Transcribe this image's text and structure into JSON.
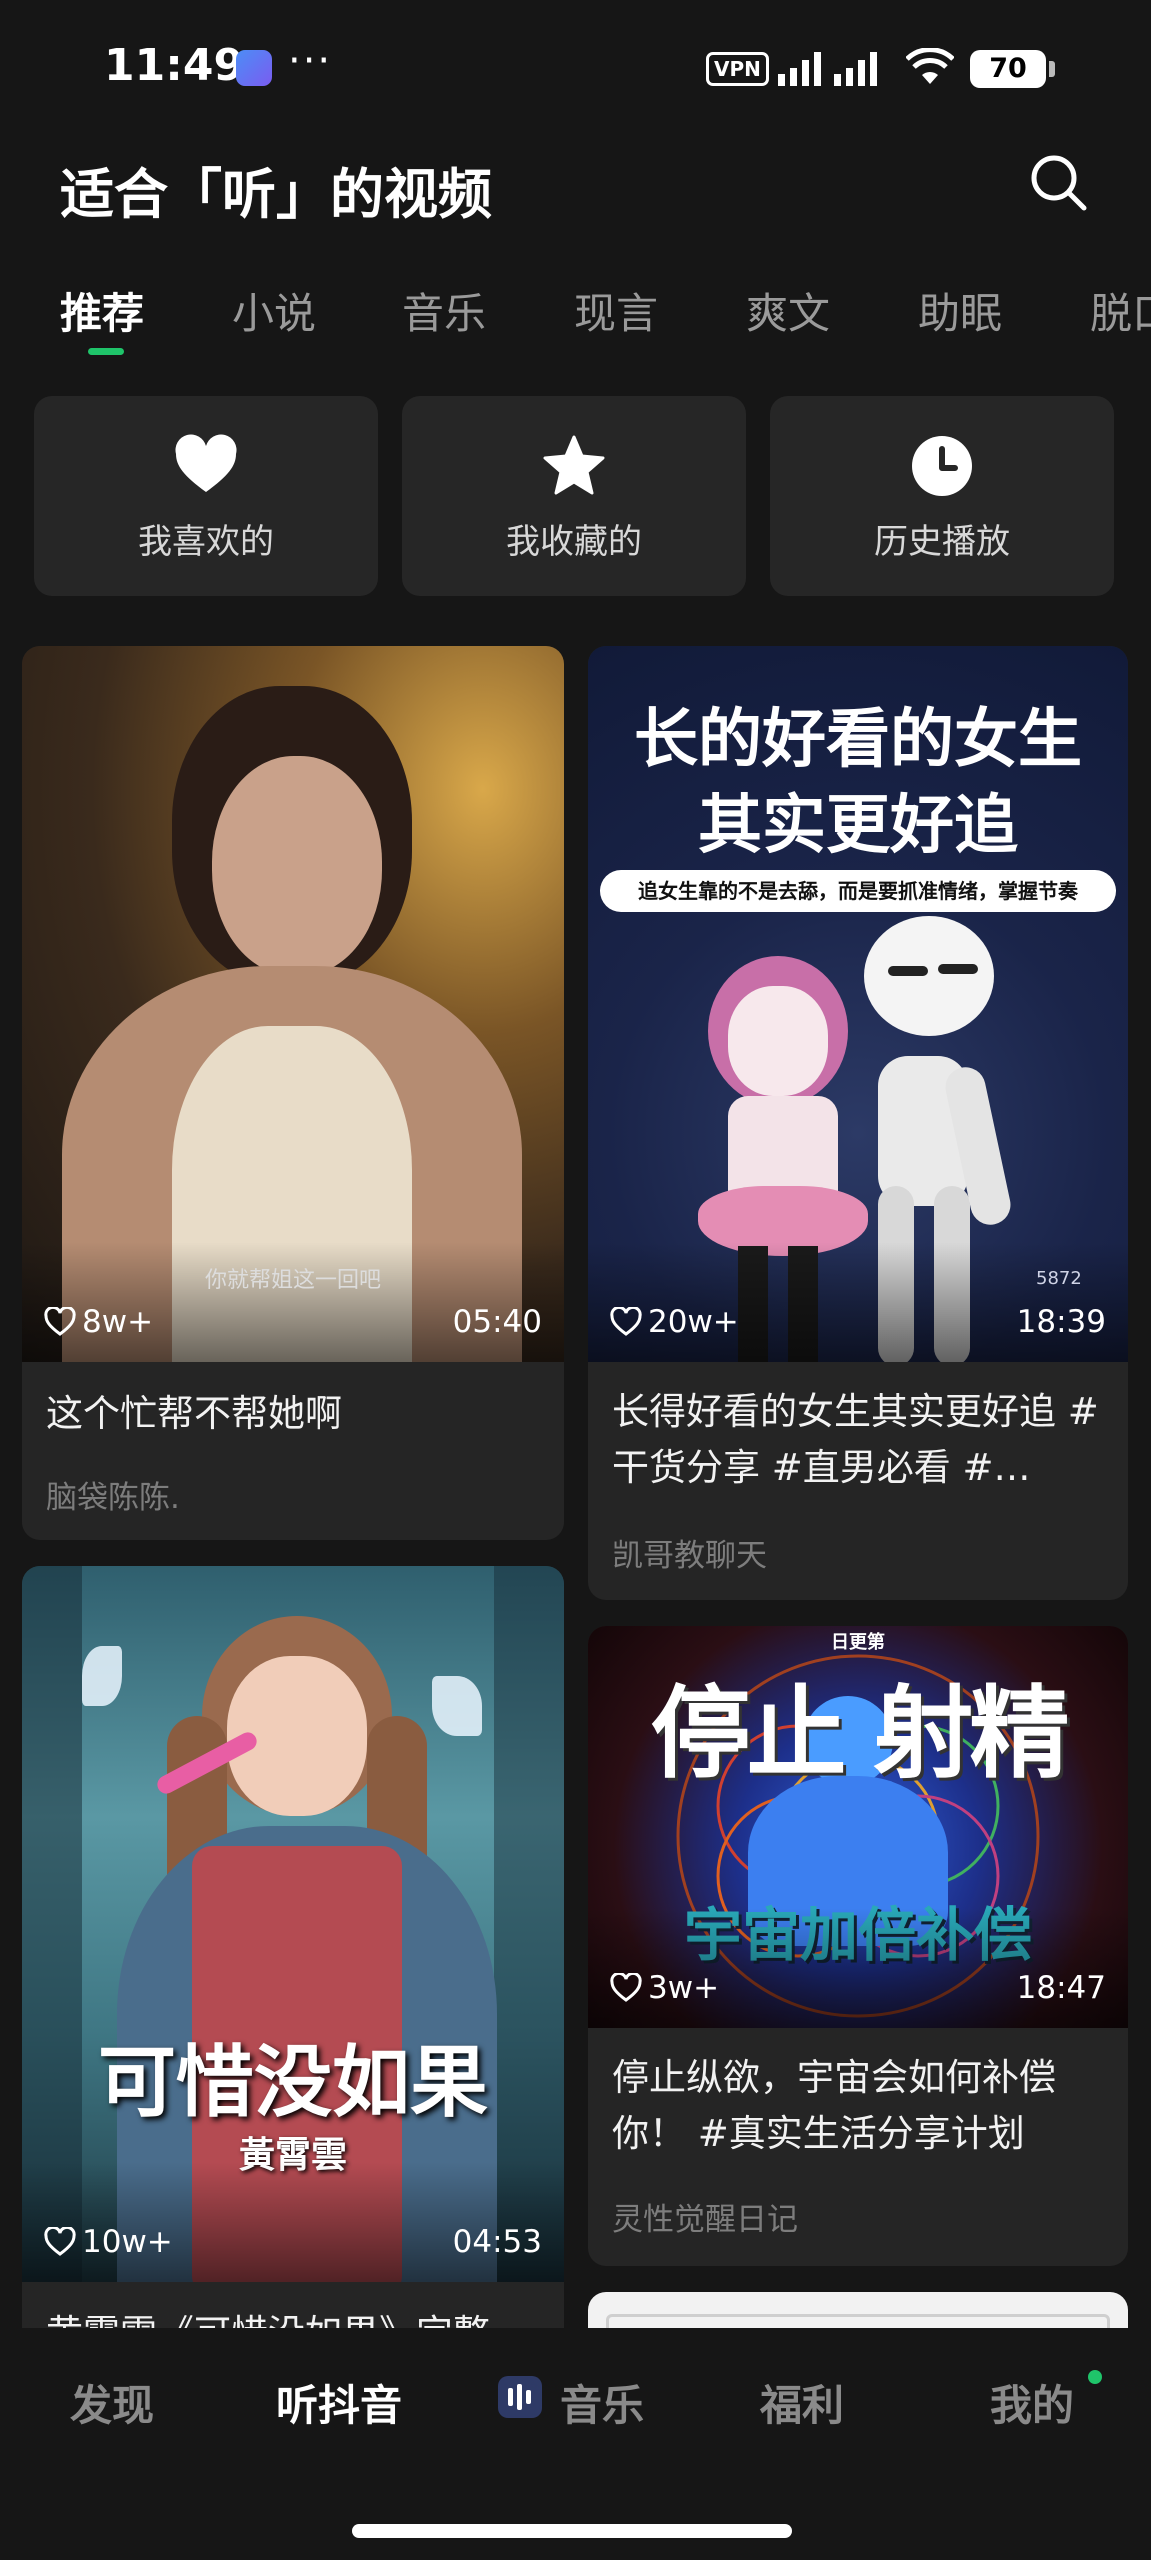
{
  "status_bar": {
    "time": "11:49",
    "dots": "···",
    "vpn": "VPN",
    "battery": "70"
  },
  "header": {
    "title": "适合「听」的视频"
  },
  "tabs": [
    {
      "label": "推荐",
      "active": true
    },
    {
      "label": "小说"
    },
    {
      "label": "音乐"
    },
    {
      "label": "现言"
    },
    {
      "label": "爽文"
    },
    {
      "label": "助眠"
    },
    {
      "label": "脱口"
    }
  ],
  "quick": [
    {
      "label": "我喜欢的",
      "icon": "heart-icon"
    },
    {
      "label": "我收藏的",
      "icon": "star-icon"
    },
    {
      "label": "历史播放",
      "icon": "clock-icon"
    }
  ],
  "cards": [
    {
      "likes": "8w+",
      "duration": "05:40",
      "title": "这个忙帮不帮她啊",
      "author": "脑袋陈陈.",
      "subtitle": "你就帮姐这一回吧"
    },
    {
      "likes": "20w+",
      "duration": "18:39",
      "title": "长得好看的女生其实更好追 #干货分享 #直男必看 #…",
      "author": "凯哥教聊天",
      "thumb_text_1": "长的好看的女生",
      "thumb_text_2": "其实更好追",
      "thumb_banner": "追女生靠的不是去舔，而是要抓准情绪，掌握节奏",
      "thumb_number": "5872"
    },
    {
      "likes": "10w+",
      "duration": "04:53",
      "title": "黄霄雲《可惜没如果》完整",
      "thumb_text_1": "可惜没如果",
      "thumb_text_2": "黃霄雲"
    },
    {
      "likes": "3w+",
      "duration": "18:47",
      "title": "停止纵欲，宇宙会如何补偿你！ #真实生活分享计划",
      "author": "灵性觉醒日记",
      "thumb_small": "日更第",
      "thumb_text_1": "停止 射精",
      "thumb_text_2": "宇宙加倍补偿"
    }
  ],
  "bottom_nav": [
    {
      "label": "发现"
    },
    {
      "label": "听抖音",
      "active": true
    },
    {
      "label": "音乐"
    },
    {
      "label": "福利"
    },
    {
      "label": "我的"
    }
  ],
  "colors": {
    "accent_green": "#1fc46a",
    "background": "#161616",
    "card": "#252525"
  }
}
